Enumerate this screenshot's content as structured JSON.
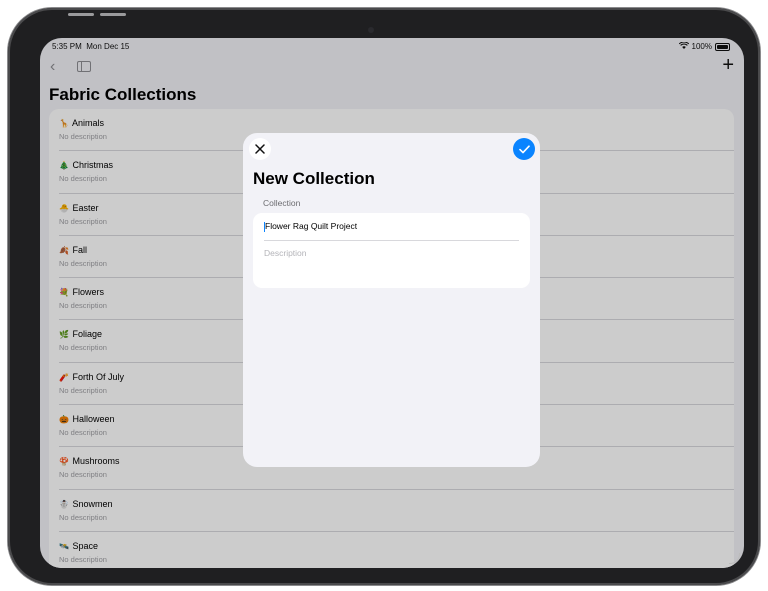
{
  "status_bar": {
    "time": "5:35 PM",
    "date": "Mon Dec 15",
    "battery": "100%"
  },
  "nav": {
    "back_icon": "chevron-left-icon",
    "sidebar_icon": "sidebar-icon",
    "add_icon": "plus-icon"
  },
  "page": {
    "title": "Fabric Collections"
  },
  "collections": [
    {
      "emoji": "🦒",
      "name": "Animals",
      "description": "No description"
    },
    {
      "emoji": "🎄",
      "name": "Christmas",
      "description": "No description"
    },
    {
      "emoji": "🐣",
      "name": "Easter",
      "description": "No description"
    },
    {
      "emoji": "🍂",
      "name": "Fall",
      "description": "No description"
    },
    {
      "emoji": "💐",
      "name": "Flowers",
      "description": "No description"
    },
    {
      "emoji": "🌿",
      "name": "Foliage",
      "description": "No description"
    },
    {
      "emoji": "🧨",
      "name": "Forth Of July",
      "description": "No description"
    },
    {
      "emoji": "🎃",
      "name": "Halloween",
      "description": "No description"
    },
    {
      "emoji": "🍄",
      "name": "Mushrooms",
      "description": "No description"
    },
    {
      "emoji": "☃️",
      "name": "Snowmen",
      "description": "No description"
    },
    {
      "emoji": "🛰️",
      "name": "Space",
      "description": "No description"
    }
  ],
  "sheet": {
    "title": "New Collection",
    "section_header": "Collection",
    "name_value": "Flower Rag Quilt Project",
    "description_placeholder": "Description",
    "close_icon": "close-icon",
    "done_icon": "checkmark-icon",
    "accent_color": "#0a84ff"
  }
}
